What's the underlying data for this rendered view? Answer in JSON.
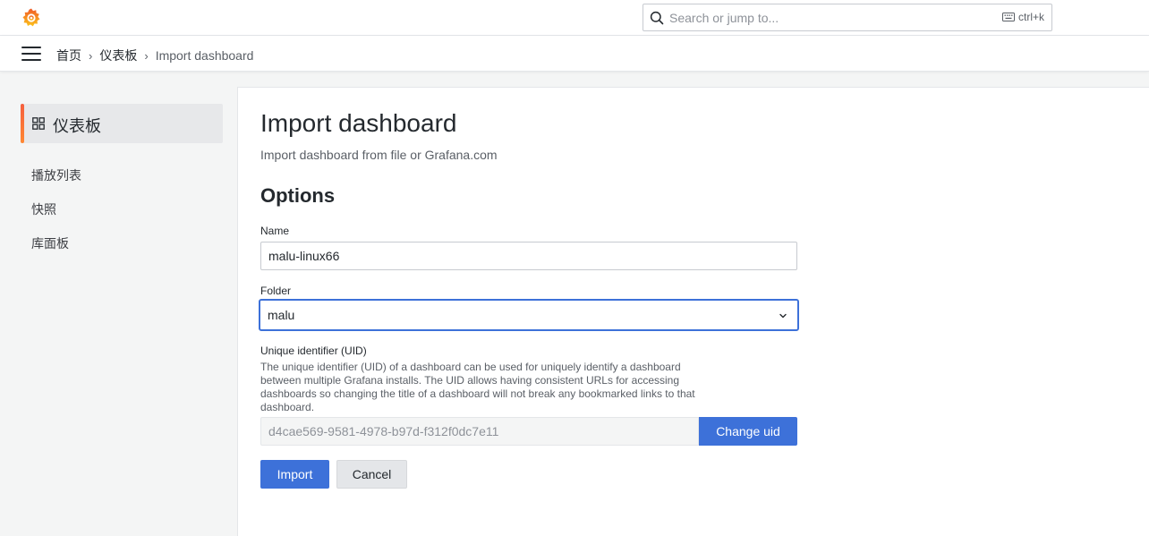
{
  "topbar": {
    "search_placeholder": "Search or jump to...",
    "shortcut": "ctrl+k"
  },
  "breadcrumb": {
    "items": [
      "首页",
      "仪表板"
    ],
    "current": "Import dashboard"
  },
  "sidebar": {
    "active": "仪表板",
    "items": [
      "播放列表",
      "快照",
      "库面板"
    ]
  },
  "page": {
    "title": "Import dashboard",
    "subtitle": "Import dashboard from file or Grafana.com",
    "section": "Options"
  },
  "form": {
    "name_label": "Name",
    "name_value": "malu-linux66",
    "folder_label": "Folder",
    "folder_value": "malu",
    "uid_label": "Unique identifier (UID)",
    "uid_description": "The unique identifier (UID) of a dashboard can be used for uniquely identify a dashboard between multiple Grafana installs. The UID allows having consistent URLs for accessing dashboards so changing the title of a dashboard will not break any bookmarked links to that dashboard.",
    "uid_value": "d4cae569-9581-4978-b97d-f312f0dc7e11",
    "change_uid_label": "Change uid",
    "import_label": "Import",
    "cancel_label": "Cancel"
  },
  "colors": {
    "primary": "#3d71d9",
    "accent_gradient_start": "#f55f3e",
    "accent_gradient_end": "#ff8833"
  }
}
